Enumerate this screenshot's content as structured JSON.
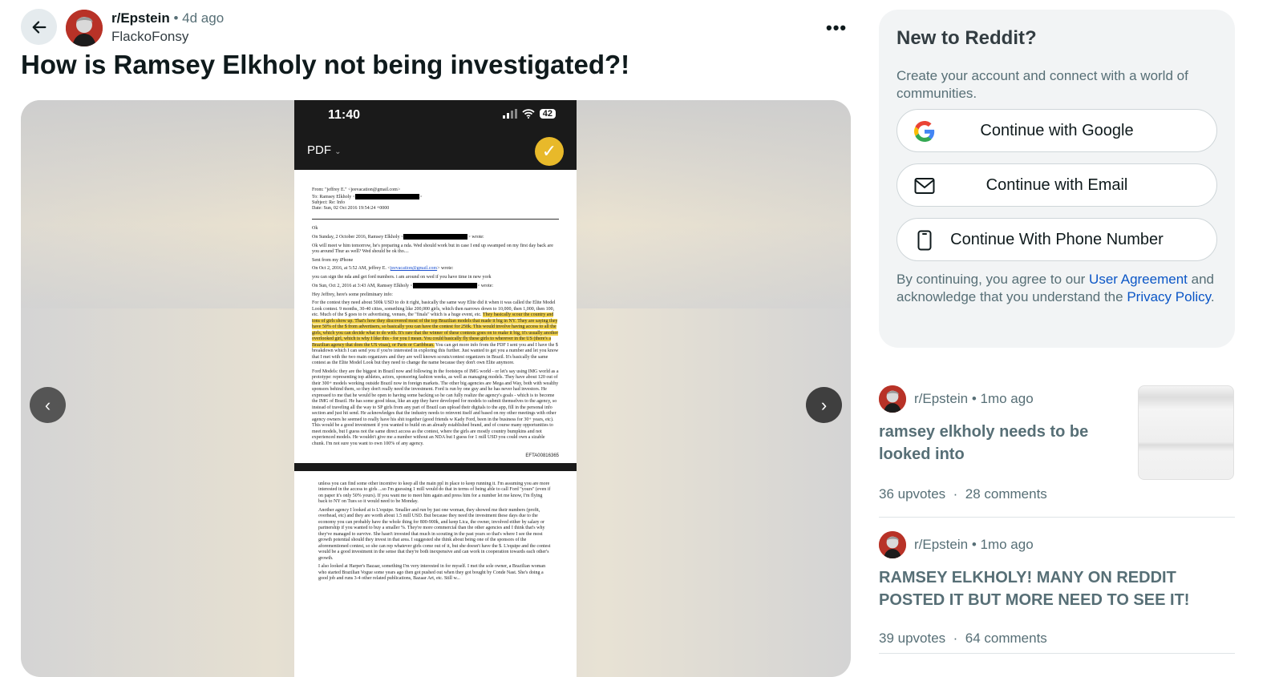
{
  "post": {
    "subreddit": "r/Epstein",
    "time_ago": "4d ago",
    "author": "FlackoFonsy",
    "title": "How is Ramsey Elkholy not being investigated?!"
  },
  "media": {
    "phone_time": "11:40",
    "battery": "42",
    "pdf_label": "PDF",
    "doc": {
      "from": "From: \"jeffrey E.\" <jeevacation@gmail.com>",
      "to": "To: Ramsey Elkholy <",
      "subject": "Subject: Re: Info",
      "date": "Date: Sun, 02 Oct 2016 19:54:24 +0000",
      "ok": "Ok",
      "line1": "On Sunday, 2 October 2016, Ramsey Elkholy <",
      "line1_end": "> wrote:",
      "line2": "Ok will meet w him tomorrow, he's preparing a nda. Wed should work but in case I end up swamped on my first day back are you around Thur as well? Wed should be ok tho....",
      "line3": "Sent from my iPhone",
      "line4": "On Oct 2, 2016, at 5:52 AM, jeffrey E. <",
      "line4_link": "jeevacation@gmail.com",
      "line4_end": "> wrote:",
      "line5": "you can sign the nda  and get ford numbers.   i am around on wed if you have time in new york",
      "line6": "On Sun, Oct 2, 2016 at 3:43 AM, Ramsey Elkholy <",
      "line6_end": "> wrote:",
      "line7": "Hey Jeffrey, here's some preliminary info:",
      "para1a": "For the contest they need about 500k USD to do it right, basically the same way Elite did it when it was called the Elite Model Look contest. 9 months, 30-40 cities, something like 200,000 girls, which then narrows down to 10,000, then 1,000, then 100, etc.  Much of the $ goes to tv advertising, venues, the \"finals\" which is a huge event, etc.",
      "para1_hl": "They basically scour the country and tons of girls show up. That's how they discovered most of the top Brazilian models that made it big in NY. They are saying they have 50% of the $ from advertisers, so basically you can have the contest for 250k. This would involve having access to all the girls, which you can decide what to do with. It's rare that the winner of these contests goes on to make it big, it's usually another overlooked girl, which is why I like this - for you I mean. You could basically fly these girls to wherever in the US (there's a Brazilian agency that does the US visas), or Paris or Caribbean.",
      "para1b": "You can get more info from the PDF I sent you and I have the $ breakdown which I can send you if you're interested in exploring this further. Just wanted to get you a number and let you know that I met with the two main organizers and they are well known scouts/contest organizers in Brazil. It's basically the same contest as the Elite Model Look but they need to change the name because they don't own Elite anymore.",
      "para2": "Ford Models: they are the biggest in Brazil now and following in the footsteps of IMG world - or let's say using IMG world as a prototype: representing top athletes, actors, sponsoring fashion weeks, as well as managing models. They have about 120 out of their 300+ models working outside Brazil now in foreign markets. The other big agencies are Mega and Way, both with wealthy sponsors behind them, so they don't really need the investment. Ford is run by one guy and he has never had investors. He expressed to me that he would be open to having some backing so he can fully realize the agency's goals - which is to become the IMG of Brazil. He has some good ideas, like an app they have developed for models to submit themselves to the agency, so instead of traveling all the way to SP girls from any part of Brazil can upload their digitals to the app, fill in the personal info section and just hit send. He acknowledges that the industry needs to reinvent itself and based on my other meetings with other agency owners he seemed to really have his shit together (good friends w Kady Ford, been in the business for 30+ years, etc). This would be a good investment if you wanted to build on an already established brand, and of course many opportunities to meet models, but I guess not the same direct access as the contest, where the girls are mostly country bumpkins and not experienced models. He wouldn't give me a number without an NDA but I guess for 1 mill USD you could own a sizable chunk. I'm not sure you want to own 100% of any agency.",
      "efta": "EFTA00816365",
      "page2_p1": "unless you can find some other incentive to keep all the main ppl in place to keep running it. I'm assuming you are more interested in the access to girls ...so I'm guessing 1 mill would do that in terms of being able to call Ford \"yours\" (even if on paper it's only 50% yours). If you want me to meet him again and press him for a number let me know, I'm flying back to NY on Tues so it would need to be Monday.",
      "page2_p2": "Another agency I looked at is L'equipe. Smaller and run by just one woman, they showed me their numbers (profit, overhead, etc) and they are worth about 1.5 mill USD. But because they need the investment these days due to the economy you can probably have the whole thing for 800-900k, and keep Lica, the owner, involved either by salary or partnership if you wanted to buy a smaller %. They're more commercial than the other agencies and I think that's why they've managed to survive. She hasn't invested that much in scouting in the past years so that's where I see the most growth potential should they invest in that area. I suggested she think about being one of the sponsors of the aforementioned contest, so she can rep whatever girls come out of it, but she doesn't have the $. L'equipe and the contest would be a good investment in the sense that they're both inexpensive and can work in cooperation towards each other's growth.",
      "page2_p3": "I also looked at Harper's Bazaar, something I'm very interested in for myself. I met the sole owner, a Brazilian woman who started Brazilian Vogue some years ago then got pushed out when they got bought by Conde Nast. She's doing a good job and runs 3-4 other related publications, Bazaar Art, etc. Still w..."
    }
  },
  "signup": {
    "heading": "New to Reddit?",
    "subtext": "Create your account and connect with a world of communities.",
    "google_label": "Continue with Google",
    "email_label": "Continue with Email",
    "phone_label": "Continue With Phone Number",
    "legal_prefix": "By continuing, you agree to our ",
    "user_agreement": "User Agreement",
    "legal_middle": " and acknowledge that you understand the ",
    "privacy_policy": "Privacy Policy",
    "legal_suffix": "."
  },
  "related": [
    {
      "subreddit": "r/Epstein",
      "time_ago": "1mo ago",
      "title": "ramsey elkholy needs to be looked into",
      "upvotes": "36 upvotes",
      "comments": "28 comments"
    },
    {
      "subreddit": "r/Epstein",
      "time_ago": "1mo ago",
      "title": "RAMSEY ELKHOLY! MANY ON REDDIT POSTED IT BUT MORE NEED TO SEE IT!",
      "upvotes": "39 upvotes",
      "comments": "64 comments"
    }
  ],
  "separators": {
    "dot": "•",
    "mid_dot": "·"
  },
  "icons": {
    "back": "arrow-left",
    "more": "ellipsis",
    "prev": "chevron-left",
    "next": "chevron-right",
    "google": "google-logo",
    "email": "envelope",
    "phone": "smartphone"
  },
  "colors": {
    "link": "#0b56c6",
    "highlight": "#f3d34a",
    "card_bg": "#f2f4f5"
  }
}
